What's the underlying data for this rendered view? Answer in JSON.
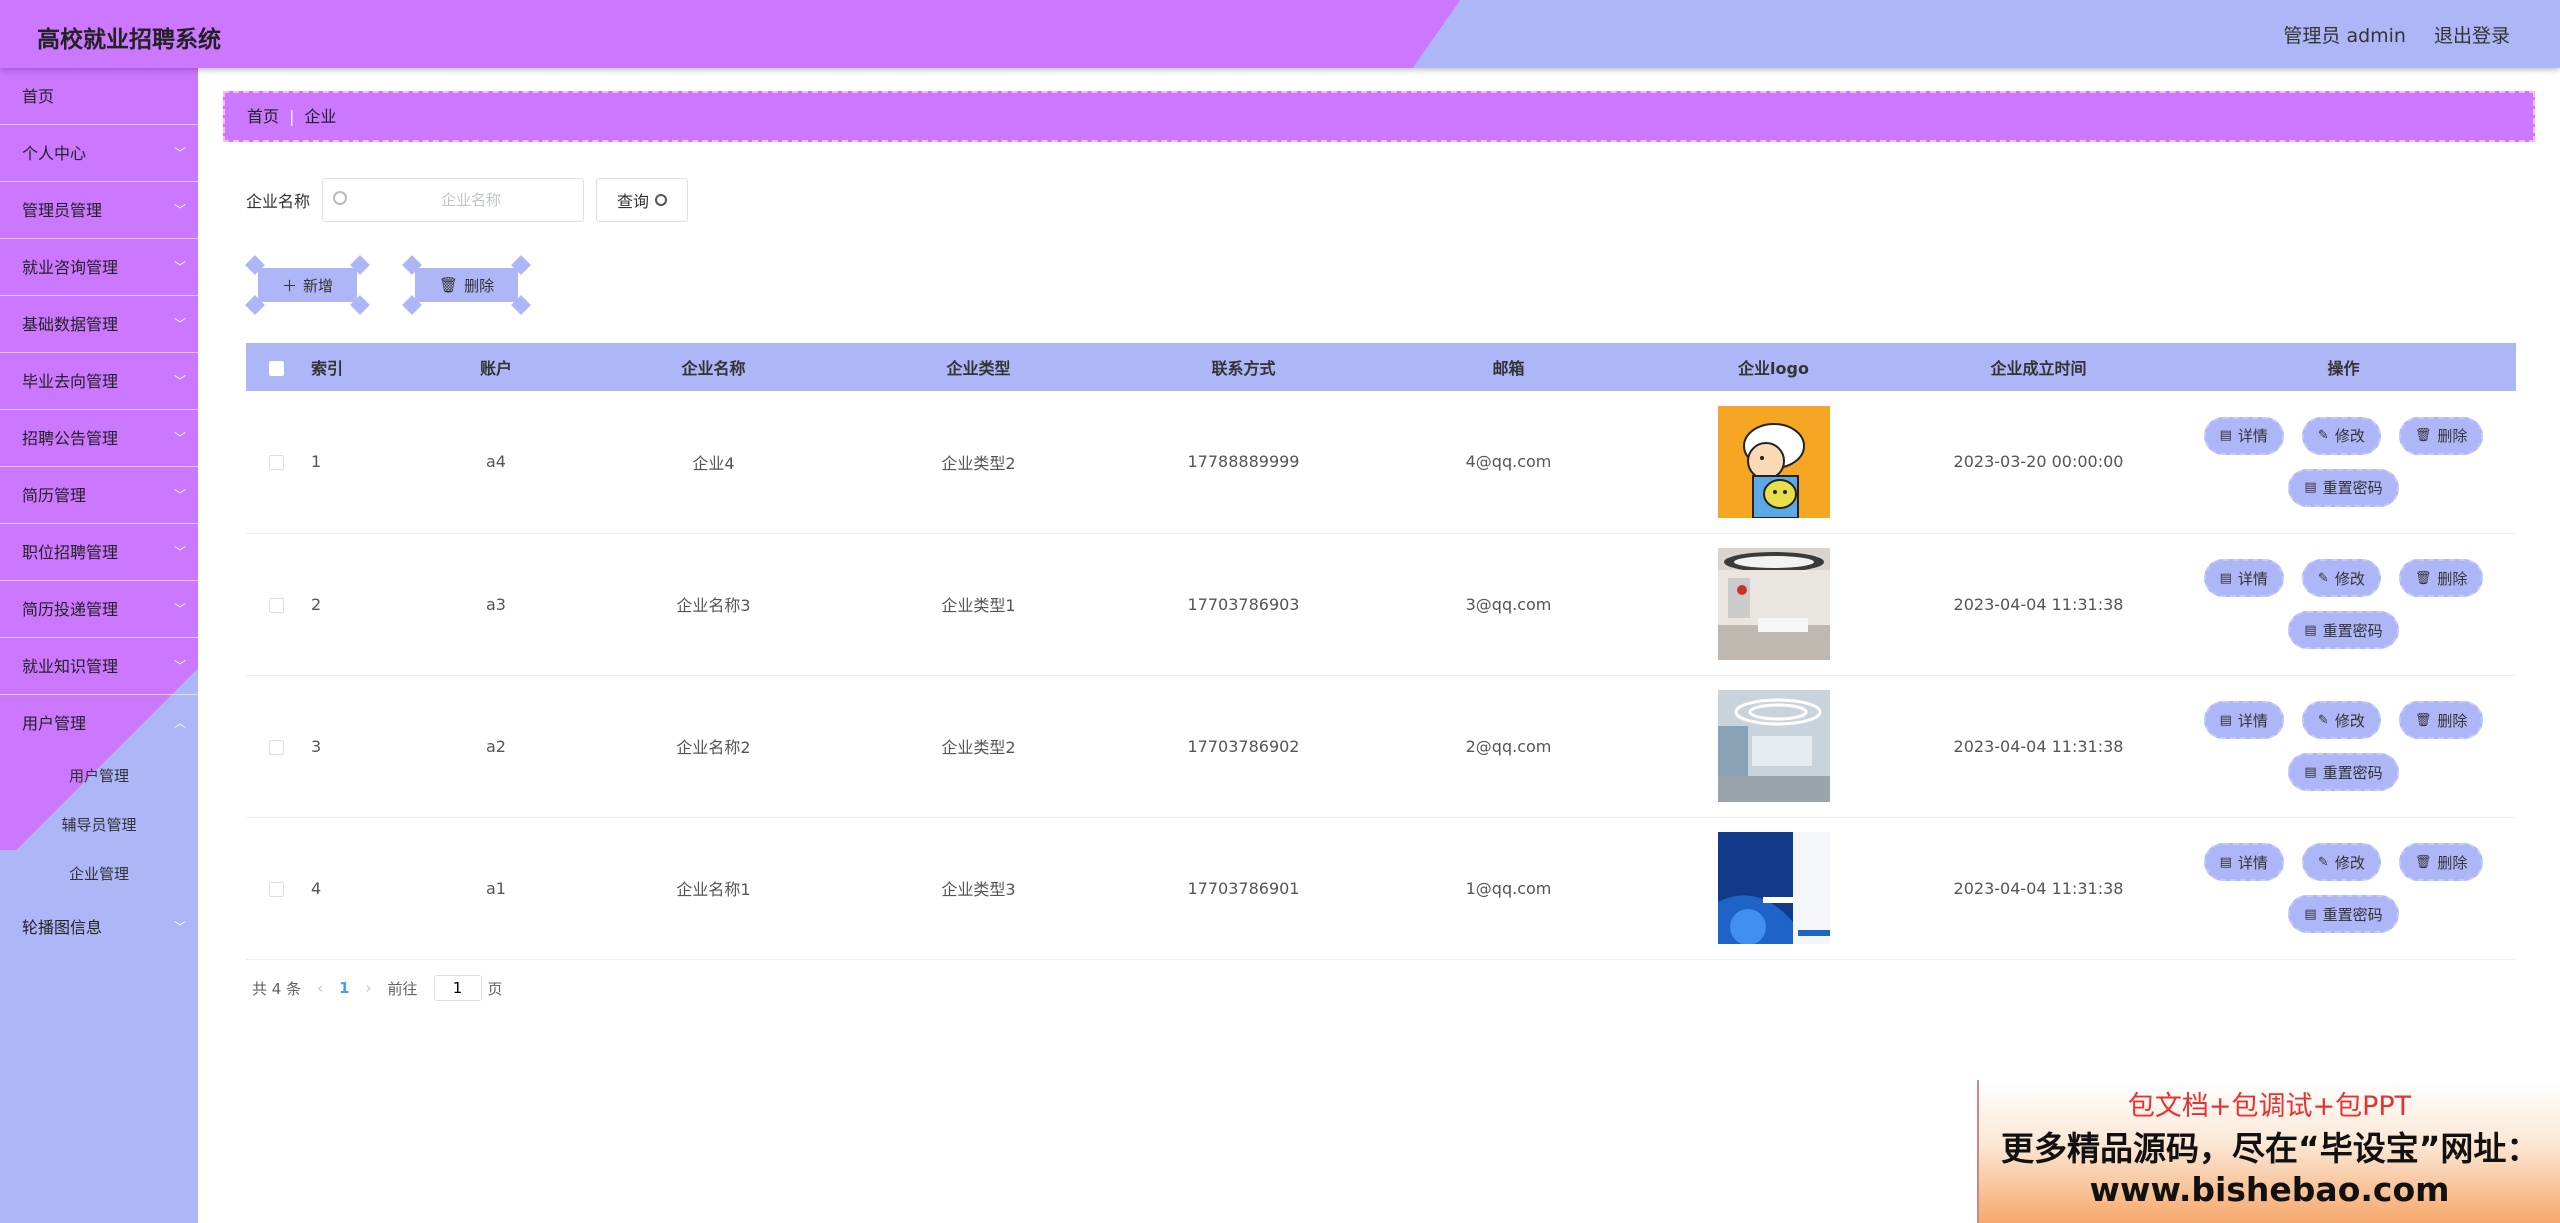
{
  "app": {
    "title": "高校就业招聘系统",
    "user": "管理员 admin",
    "logout": "退出登录"
  },
  "sidebar": {
    "items": [
      {
        "label": "首页",
        "has_children": false
      },
      {
        "label": "个人中心",
        "has_children": true
      },
      {
        "label": "管理员管理",
        "has_children": true
      },
      {
        "label": "就业咨询管理",
        "has_children": true
      },
      {
        "label": "基础数据管理",
        "has_children": true
      },
      {
        "label": "毕业去向管理",
        "has_children": true
      },
      {
        "label": "招聘公告管理",
        "has_children": true
      },
      {
        "label": "简历管理",
        "has_children": true
      },
      {
        "label": "职位招聘管理",
        "has_children": true
      },
      {
        "label": "简历投递管理",
        "has_children": true
      },
      {
        "label": "就业知识管理",
        "has_children": true
      },
      {
        "label": "用户管理",
        "has_children": true,
        "expanded": true
      }
    ],
    "sub_items": [
      "用户管理",
      "辅导员管理",
      "企业管理"
    ],
    "active_sub": "企业管理",
    "last_item": "轮播图信息"
  },
  "breadcrumb": {
    "home": "首页",
    "current": "企业"
  },
  "search": {
    "label": "企业名称",
    "placeholder": "企业名称",
    "button": "查询"
  },
  "actions": {
    "add": "新增",
    "delete": "删除"
  },
  "table": {
    "headers": [
      "索引",
      "账户",
      "企业名称",
      "企业类型",
      "联系方式",
      "邮箱",
      "企业logo",
      "企业成立时间",
      "操作"
    ],
    "rows": [
      {
        "index": "1",
        "account": "a4",
        "name": "企业4",
        "type": "企业类型2",
        "phone": "17788889999",
        "email": "4@qq.com",
        "logo": "cartoon-logo",
        "founded": "2023-03-20 00:00:00"
      },
      {
        "index": "2",
        "account": "a3",
        "name": "企业名称3",
        "type": "企业类型1",
        "phone": "17703786903",
        "email": "3@qq.com",
        "logo": "lobby-photo",
        "founded": "2023-04-04 11:31:38"
      },
      {
        "index": "3",
        "account": "a2",
        "name": "企业名称2",
        "type": "企业类型2",
        "phone": "17703786902",
        "email": "2@qq.com",
        "logo": "office-photo",
        "founded": "2023-04-04 11:31:38"
      },
      {
        "index": "4",
        "account": "a1",
        "name": "企业名称1",
        "type": "企业类型3",
        "phone": "17703786901",
        "email": "1@qq.com",
        "logo": "brochure-cover",
        "founded": "2023-04-04 11:31:38"
      }
    ],
    "ops": {
      "detail": "详情",
      "edit": "修改",
      "delete": "删除",
      "reset": "重置密码"
    }
  },
  "pagination": {
    "total": "共 4 条",
    "current": "1",
    "goto_label": "前往",
    "goto_value": "1",
    "page_suffix": "页"
  },
  "ad": {
    "line1": "包文档+包调试+包PPT",
    "line2": "更多精品源码，尽在“毕设宝”网址：",
    "line3": "www.bishebao.com"
  },
  "colors": {
    "purple": "#cc77ff",
    "lavender": "#adb6f7"
  }
}
